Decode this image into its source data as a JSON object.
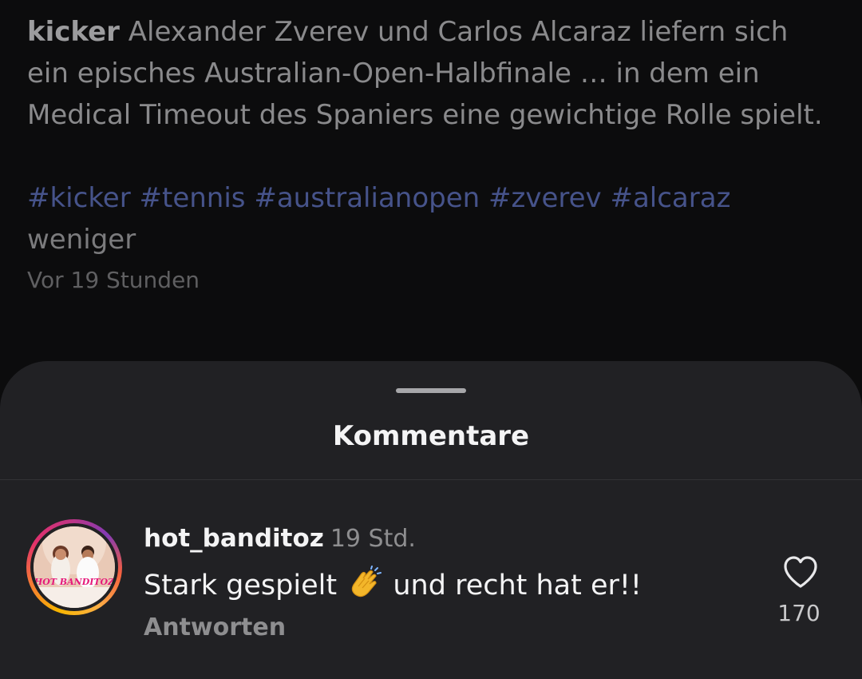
{
  "post": {
    "author": "kicker",
    "caption": "Alexander Zverev und Carlos Alcaraz liefern sich ein episches Australian-Open-Halbfinale … in dem ein Medical Timeout des Spaniers eine gewichtige Rolle spielt.",
    "hashtags": [
      "#kicker",
      "#tennis",
      "#australianopen",
      "#zverev",
      "#alcaraz"
    ],
    "less_label": "weniger",
    "timestamp": "Vor 19 Stunden"
  },
  "comments_sheet": {
    "title": "Kommentare",
    "comments": [
      {
        "username": "hot_banditoz",
        "time": "19 Std.",
        "text_before": "Stark gespielt",
        "emoji": "clapping-hands-icon",
        "text_after": "und recht hat er!!",
        "reply_label": "Antworten",
        "likes": "170",
        "avatar_logo_text": "HOT BANDITOZ"
      }
    ]
  },
  "colors": {
    "background": "#0c0c0d",
    "sheet": "#212124",
    "hashtag": "#46538a",
    "text_primary": "#f4f4f5",
    "text_secondary": "#8e8e90"
  }
}
